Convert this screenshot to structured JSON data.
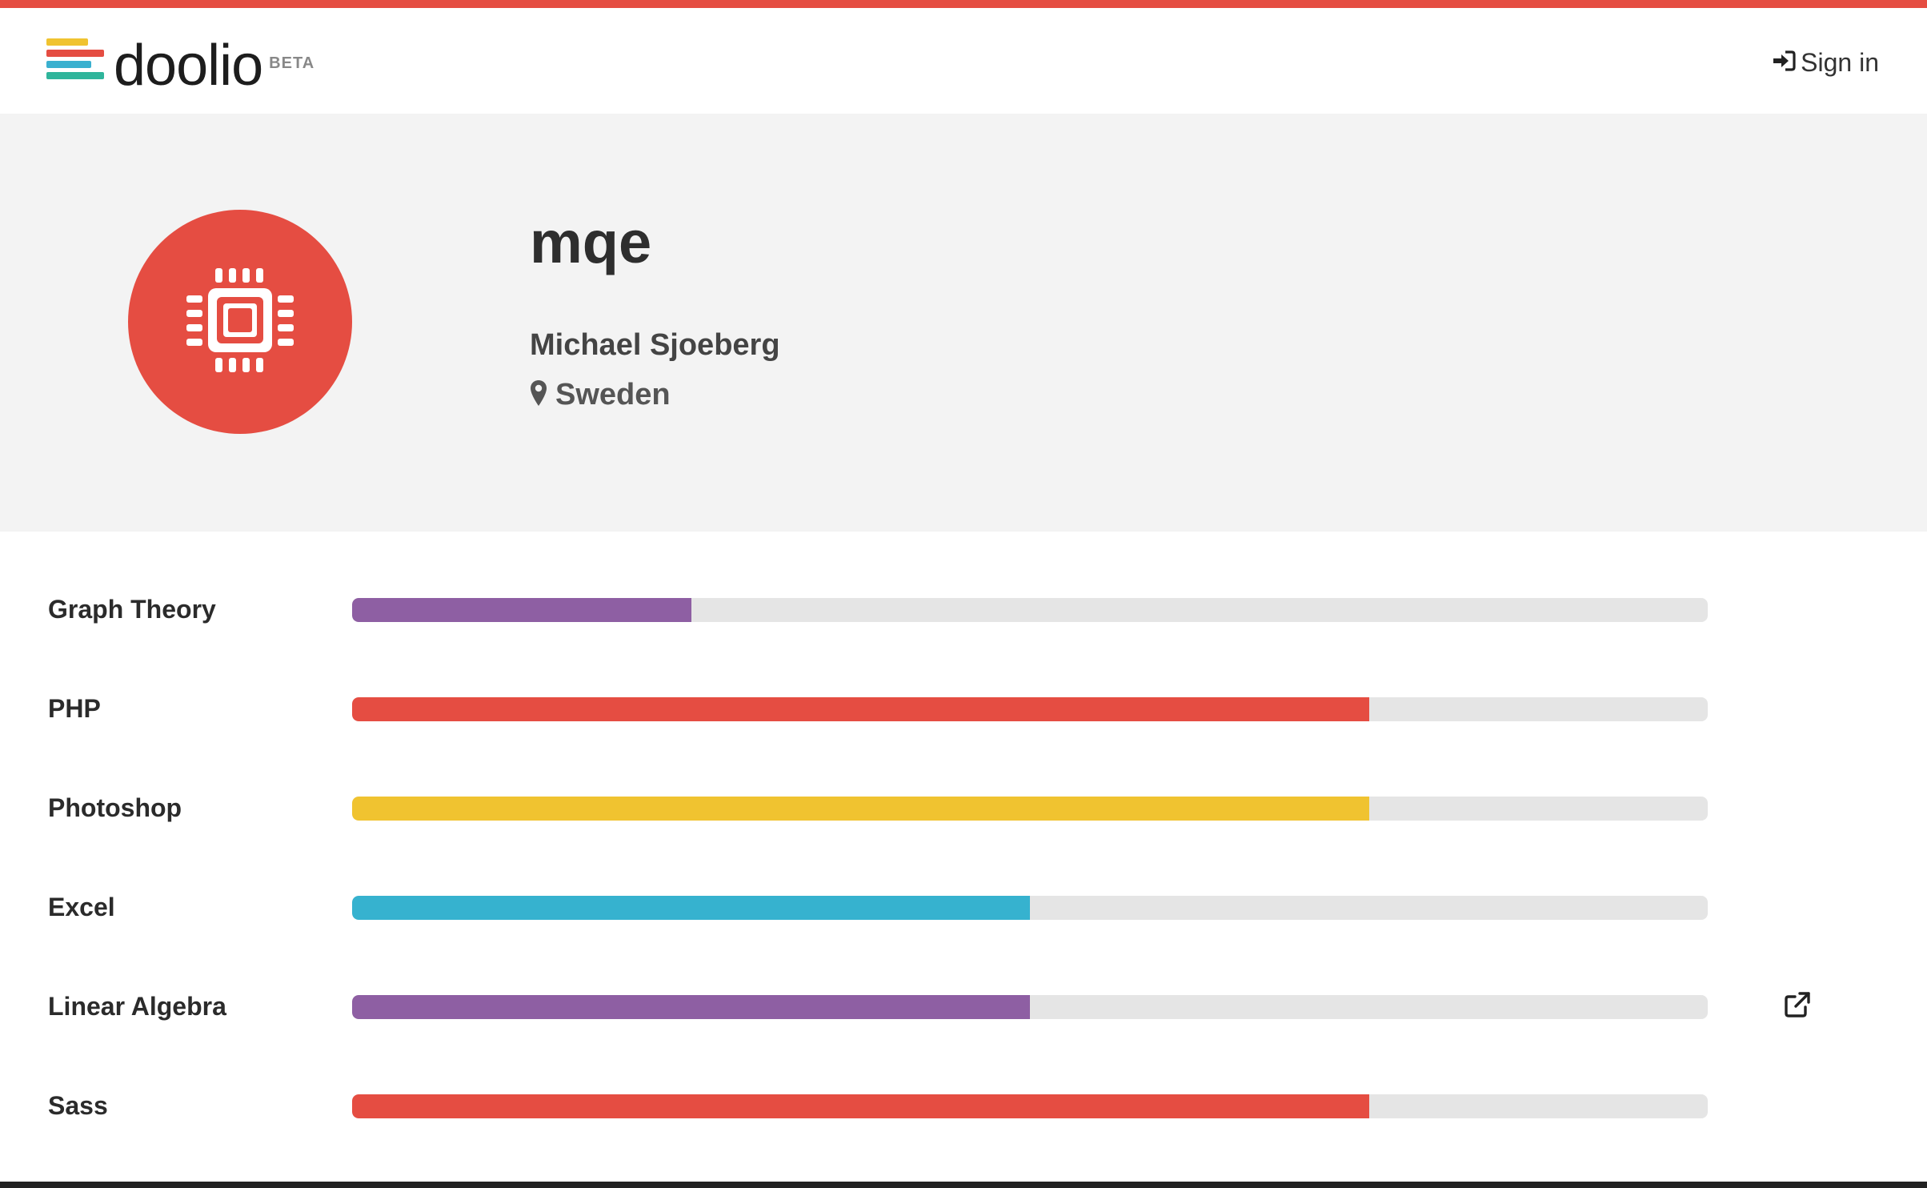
{
  "header": {
    "logo_text": "doolio",
    "logo_badge": "BETA",
    "logo_colors": [
      "#f0c330",
      "#e54d42",
      "#3ab0cf",
      "#2fb59b"
    ],
    "signin_label": "Sign in",
    "signin_icon": "sign-in-icon"
  },
  "profile": {
    "avatar_icon": "microchip-icon",
    "avatar_color": "#e54d42",
    "username": "mqe",
    "full_name": "Michael Sjoeberg",
    "location_icon": "map-marker-icon",
    "location": "Sweden"
  },
  "skills": [
    {
      "name": "Graph Theory",
      "level": 0.25,
      "color": "#8e5fa3"
    },
    {
      "name": "PHP",
      "level": 0.75,
      "color": "#e54d42"
    },
    {
      "name": "Photoshop",
      "level": 0.75,
      "color": "#f0c330"
    },
    {
      "name": "Excel",
      "level": 0.5,
      "color": "#36b2cf"
    },
    {
      "name": "Linear Algebra",
      "level": 0.5,
      "color": "#8e5fa3",
      "external_link_icon": "external-link-icon"
    },
    {
      "name": "Sass",
      "level": 0.75,
      "color": "#e54d42"
    }
  ]
}
